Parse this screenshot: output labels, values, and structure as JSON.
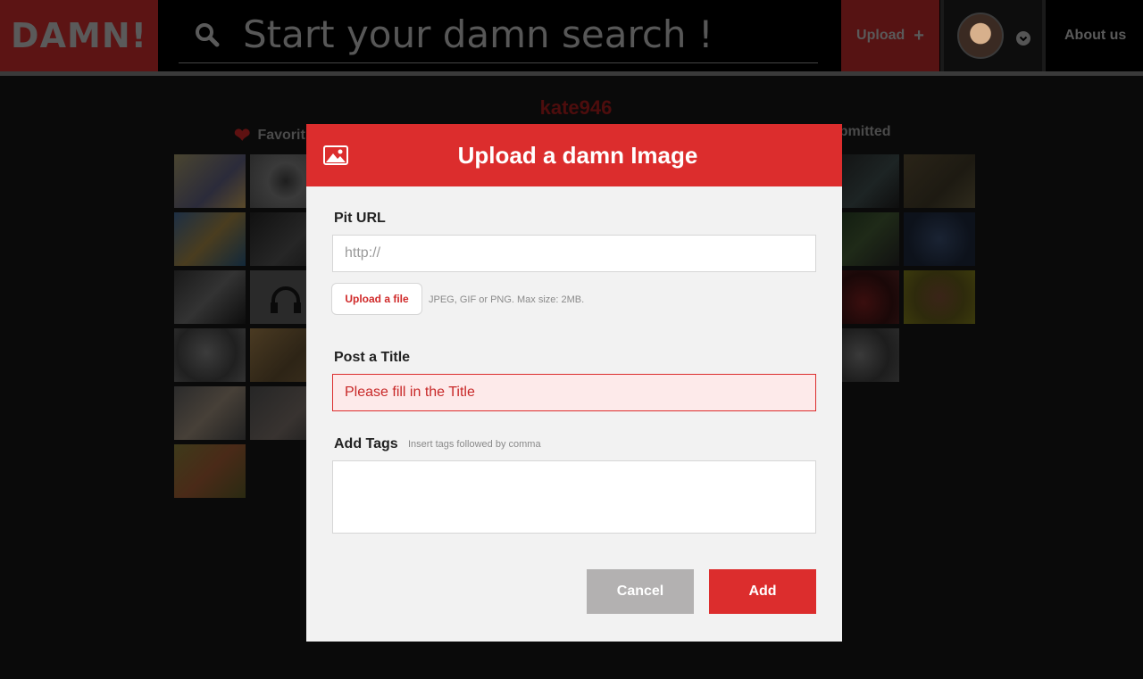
{
  "header": {
    "logo": "DAMN!",
    "search_placeholder": "Start your damn search !",
    "upload_label": "Upload",
    "upload_plus": "+",
    "about_label": "About us"
  },
  "profile": {
    "username": "kate946",
    "favorites_label": "Favorit",
    "submitted_label": "ubmitted"
  },
  "modal": {
    "title": "Upload a damn Image",
    "url_label": "Pit URL",
    "url_placeholder": "http://",
    "upload_file_label": "Upload a file",
    "file_hint": "JPEG, GIF or PNG. Max size: 2MB.",
    "title_label": "Post a Title",
    "title_placeholder": "Please fill in the Title",
    "tags_label": "Add Tags",
    "tags_hint": "Insert tags followed by comma",
    "cancel_label": "Cancel",
    "add_label": "Add"
  },
  "colors": {
    "accent": "#dc2d2d",
    "modal_bg": "#f2f2f2",
    "cancel_bg": "#b3b1b1",
    "error_bg": "#fdeaea"
  },
  "icons": [
    "search-icon",
    "plus-icon",
    "chevron-down-icon",
    "heart-icon",
    "image-icon"
  ]
}
